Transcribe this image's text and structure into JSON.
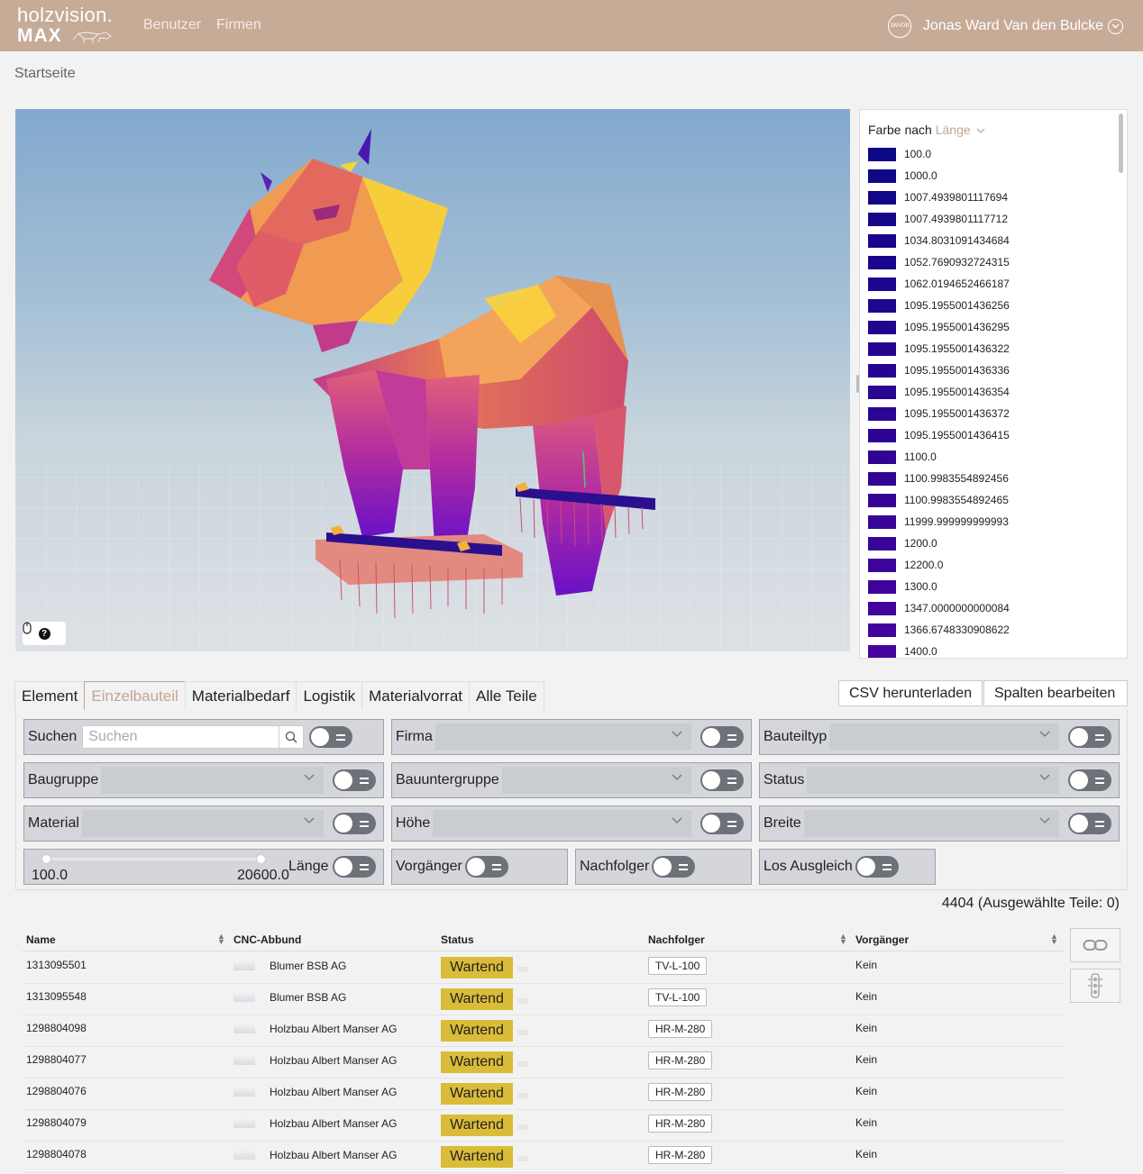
{
  "header": {
    "logo_line1": "holzvision.",
    "logo_line2": "MAX",
    "nav": [
      "Benutzer",
      "Firmen"
    ],
    "user_initials": "JWVDB",
    "user_name": "Jonas Ward Van den Bulcke"
  },
  "breadcrumb": "Startseite",
  "legend": {
    "label": "Farbe nach",
    "attribute": "Länge",
    "items": [
      {
        "value": "100.0",
        "color": "#0d0887"
      },
      {
        "value": "1000.0",
        "color": "#100788"
      },
      {
        "value": "1007.4939801117694",
        "color": "#120789"
      },
      {
        "value": "1007.4939801117712",
        "color": "#14078a"
      },
      {
        "value": "1034.8031091434684",
        "color": "#17068b"
      },
      {
        "value": "1052.7690932724315",
        "color": "#19068c"
      },
      {
        "value": "1062.0194652466187",
        "color": "#1c068d"
      },
      {
        "value": "1095.1955001436256",
        "color": "#1e068e"
      },
      {
        "value": "1095.1955001436295",
        "color": "#21058f"
      },
      {
        "value": "1095.1955001436322",
        "color": "#230590"
      },
      {
        "value": "1095.1955001436336",
        "color": "#260591"
      },
      {
        "value": "1095.1955001436354",
        "color": "#280592"
      },
      {
        "value": "1095.1955001436372",
        "color": "#2a0593"
      },
      {
        "value": "1095.1955001436415",
        "color": "#2d0494"
      },
      {
        "value": "1100.0",
        "color": "#2f0495"
      },
      {
        "value": "1100.9983554892456",
        "color": "#320496"
      },
      {
        "value": "1100.9983554892465",
        "color": "#340497"
      },
      {
        "value": "11999.999999999993",
        "color": "#370498"
      },
      {
        "value": "1200.0",
        "color": "#390499"
      },
      {
        "value": "12200.0",
        "color": "#3c049a"
      },
      {
        "value": "1300.0",
        "color": "#3e039b"
      },
      {
        "value": "1347.0000000000084",
        "color": "#41039c"
      },
      {
        "value": "1366.6748330908622",
        "color": "#43039d"
      },
      {
        "value": "1400.0",
        "color": "#46039e"
      }
    ]
  },
  "tabs": [
    "Element",
    "Einzelbauteil",
    "Materialbedarf",
    "Logistik",
    "Materialvorrat",
    "Alle Teile"
  ],
  "actions": {
    "csv": "CSV herunterladen",
    "columns": "Spalten bearbeiten"
  },
  "filters": {
    "search_label": "Suchen",
    "search_placeholder": "Suchen",
    "firma": "Firma",
    "bauteiltyp": "Bauteiltyp",
    "baugruppe": "Baugruppe",
    "bauuntergruppe": "Bauuntergruppe",
    "status": "Status",
    "material": "Material",
    "hoehe": "Höhe",
    "breite": "Breite",
    "laenge_min": "100.0",
    "laenge_max": "20600.0",
    "laenge": "Länge",
    "vorgaenger": "Vorgänger",
    "nachfolger": "Nachfolger",
    "los_ausgleich": "Los Ausgleich"
  },
  "count_text": "4404 (Ausgewählte Teile: 0)",
  "table": {
    "columns": [
      "Name",
      "CNC-Abbund",
      "Status",
      "Nachfolger",
      "Vorgänger"
    ],
    "rows": [
      {
        "name": "1313095501",
        "cnc": "Blumer BSB AG",
        "status": "Wartend",
        "nachfolger": "TV-L-100",
        "vorgaenger": "Kein"
      },
      {
        "name": "1313095548",
        "cnc": "Blumer BSB AG",
        "status": "Wartend",
        "nachfolger": "TV-L-100",
        "vorgaenger": "Kein"
      },
      {
        "name": "1298804098",
        "cnc": "Holzbau Albert Manser AG",
        "status": "Wartend",
        "nachfolger": "HR-M-280",
        "vorgaenger": "Kein"
      },
      {
        "name": "1298804077",
        "cnc": "Holzbau Albert Manser AG",
        "status": "Wartend",
        "nachfolger": "HR-M-280",
        "vorgaenger": "Kein"
      },
      {
        "name": "1298804076",
        "cnc": "Holzbau Albert Manser AG",
        "status": "Wartend",
        "nachfolger": "HR-M-280",
        "vorgaenger": "Kein"
      },
      {
        "name": "1298804079",
        "cnc": "Holzbau Albert Manser AG",
        "status": "Wartend",
        "nachfolger": "HR-M-280",
        "vorgaenger": "Kein"
      },
      {
        "name": "1298804078",
        "cnc": "Holzbau Albert Manser AG",
        "status": "Wartend",
        "nachfolger": "HR-M-280",
        "vorgaenger": "Kein"
      }
    ]
  },
  "colors": {
    "header": "#c6ab97",
    "accent": "#c3a591",
    "status_wartend": "#dbbc38"
  }
}
